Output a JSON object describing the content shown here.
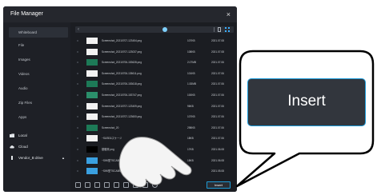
{
  "window": {
    "title": "File Manager",
    "close_glyph": "×"
  },
  "sidebar": {
    "items": [
      {
        "label": "Whiteboard",
        "active": true
      },
      {
        "label": "File"
      },
      {
        "label": "Images"
      },
      {
        "label": "Videos"
      },
      {
        "label": "Audio"
      },
      {
        "label": "Zip Files"
      },
      {
        "label": "Apps"
      }
    ],
    "locations": [
      {
        "label": "Local",
        "icon": "folder-icon"
      },
      {
        "label": "Cloud",
        "icon": "cloud-icon"
      },
      {
        "label": "Vendor_B drive",
        "icon": "usb-drive-icon",
        "eject": "▲"
      }
    ]
  },
  "toolbar": {
    "back_glyph": "‹"
  },
  "files": [
    {
      "name": "Screenshot_20210707-123454.png",
      "size": "107KB",
      "date": "2021.07.08",
      "thumb": "#f2f2f2"
    },
    {
      "name": "Screenshot_20210707-123037.png",
      "size": "108KB",
      "date": "2021.07.08",
      "thumb": "#f2f2f2"
    },
    {
      "name": "Screenshot_20210706-153628.png",
      "size": "2.07MB",
      "date": "2021.07.06",
      "thumb": "#1d7a57"
    },
    {
      "name": "Screenshot_20210706-135611.png",
      "size": "101KB",
      "date": "2021.07.06",
      "thumb": "#f2f2f2"
    },
    {
      "name": "Screenshot_20210706-153618.png",
      "size": "1.53MB",
      "date": "2021.07.06",
      "thumb": "#1d7a57"
    },
    {
      "name": "Screenshot_20210706-153747.png",
      "size": "100KB",
      "date": "2021.07.06",
      "thumb": "#2b8f6b"
    },
    {
      "name": "Screenshot_20210707-123409.png",
      "size": "96KB",
      "date": "2021.07.06",
      "thumb": "#f2f2f2"
    },
    {
      "name": "Screenshot_20210707-123600.png",
      "size": "107KB",
      "date": "2021.07.06",
      "thumb": "#f2f2f2"
    },
    {
      "name": "Screenshot_20",
      "size": "298KB",
      "date": "2021.07.06",
      "thumb": "#1d7a57"
    },
    {
      "name": "~SUSE&スケージ",
      "size": "18KB",
      "date": "2021.07.06",
      "thumb": "#f2f2f2"
    },
    {
      "name": "基礎資.png",
      "size": "17KB",
      "date": "2021.06.08",
      "thumb": "#000000"
    },
    {
      "name": "~SWI型TSCA5B_PX",
      "size": "18KB",
      "date": "2021.06.08",
      "thumb": "#3aa0e0"
    },
    {
      "name": "~SWI型TSCA5B_210320.pptx",
      "size": "",
      "date": "2021.05.08",
      "thumb": "#3aa0e0"
    }
  ],
  "bottom_toolbar": {
    "insert_label": "Insert",
    "tools": [
      "select-icon",
      "copy-icon",
      "cut-icon",
      "paste-icon",
      "delete-icon",
      "rename-icon",
      "share-icon",
      "sort-icon",
      "settings-icon"
    ]
  },
  "callout": {
    "label": "Insert"
  },
  "colors": {
    "accent": "#1a9ad8",
    "window_bg": "#1b1d22",
    "callout_bg": "#32363d"
  }
}
